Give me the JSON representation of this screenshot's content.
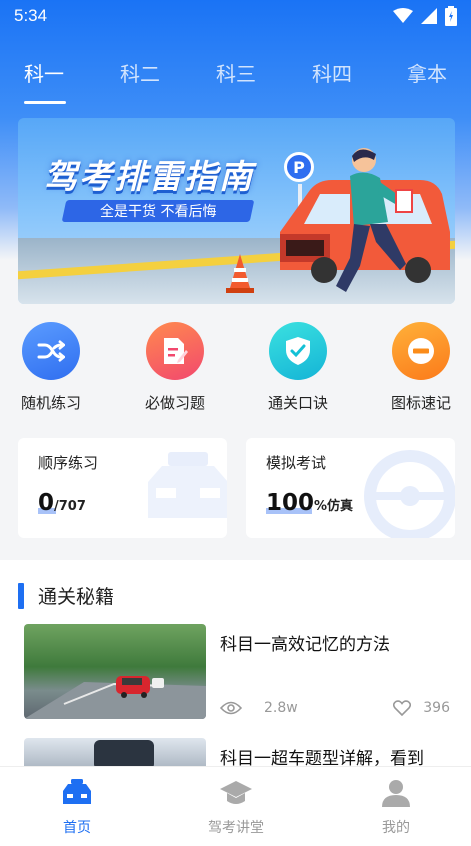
{
  "status_bar": {
    "time": "5:34"
  },
  "tabs": [
    {
      "label": "科一",
      "active": true
    },
    {
      "label": "科二",
      "active": false
    },
    {
      "label": "科三",
      "active": false
    },
    {
      "label": "科四",
      "active": false
    },
    {
      "label": "拿本",
      "active": false
    }
  ],
  "banner": {
    "title": "驾考排雷指南",
    "subtitle": "全是干货 不看后悔",
    "sign": "P"
  },
  "shortcuts": [
    {
      "label": "随机练习",
      "icon": "shuffle-icon",
      "color": "#2f6ef0"
    },
    {
      "label": "必做习题",
      "icon": "document-edit-icon",
      "color": "#f2486e"
    },
    {
      "label": "通关口诀",
      "icon": "shield-check-icon",
      "color": "#14c1d6"
    },
    {
      "label": "图标速记",
      "icon": "minus-circle-icon",
      "color": "#fb8c1a"
    }
  ],
  "cards": {
    "sequential": {
      "title": "顺序练习",
      "value": "0",
      "total": "/707"
    },
    "mock_exam": {
      "title": "模拟考试",
      "value": "100",
      "suffix": "%仿真"
    }
  },
  "section": {
    "title": "通关秘籍",
    "articles": [
      {
        "title": "科目一高效记忆的方法",
        "views": "2.8w",
        "likes": "396"
      },
      {
        "title": "科目一超车题型详解，看到"
      }
    ]
  },
  "bottom_nav": [
    {
      "label": "首页",
      "icon": "car-icon",
      "active": true
    },
    {
      "label": "驾考讲堂",
      "icon": "graduation-cap-icon",
      "active": false
    },
    {
      "label": "我的",
      "icon": "user-icon",
      "active": false
    }
  ],
  "colors": {
    "primary": "#1e6ff2",
    "header_gradient_top": "#1a73f5"
  }
}
